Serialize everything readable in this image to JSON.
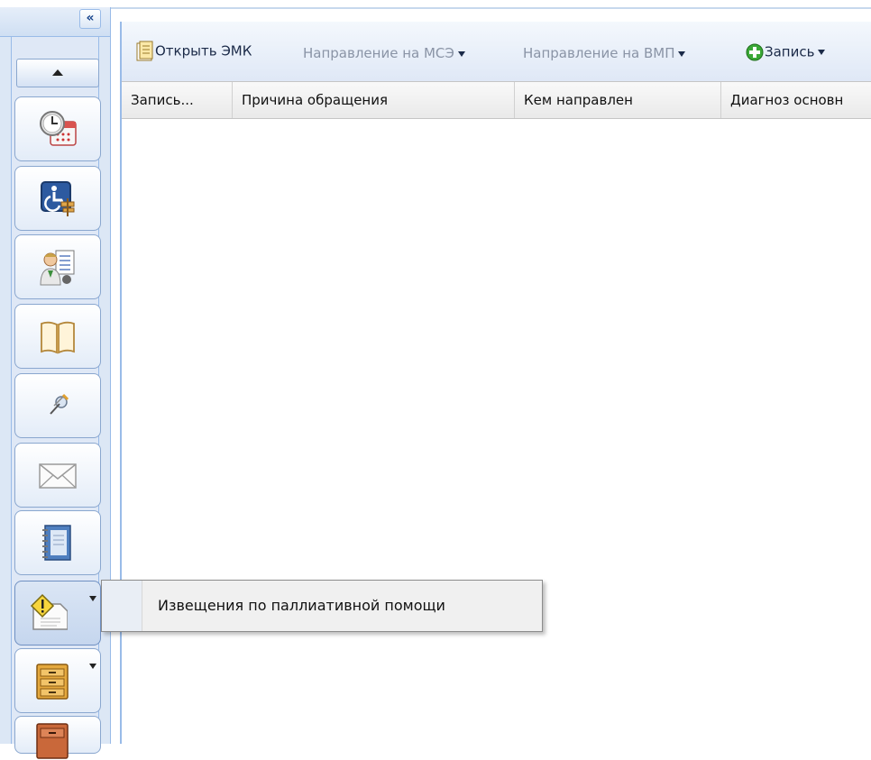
{
  "toolbar": {
    "open_emk": "Открыть ЭМК",
    "mse": "Направление на МСЭ",
    "vmp": "Направление на ВМП",
    "zapis": "Запись"
  },
  "grid": {
    "columns": [
      "Запись...",
      "Причина обращения",
      "Кем направлен",
      "Диагноз основн"
    ]
  },
  "popup": {
    "item_label": "Извещения по паллиативной помощи"
  },
  "sidebar": {
    "items": [
      {
        "icon": "clock-calendar-icon"
      },
      {
        "icon": "disability-icon"
      },
      {
        "icon": "doctor-document-icon"
      },
      {
        "icon": "open-book-icon"
      },
      {
        "icon": "pushpin-icon"
      },
      {
        "icon": "envelope-icon"
      },
      {
        "icon": "notebook-icon"
      },
      {
        "icon": "warning-document-icon"
      },
      {
        "icon": "cabinet-icon"
      },
      {
        "icon": "cabinet-red-icon"
      }
    ]
  },
  "colors": {
    "accent": "#99bbe8",
    "sidebar_bg": "#dce7f5"
  }
}
